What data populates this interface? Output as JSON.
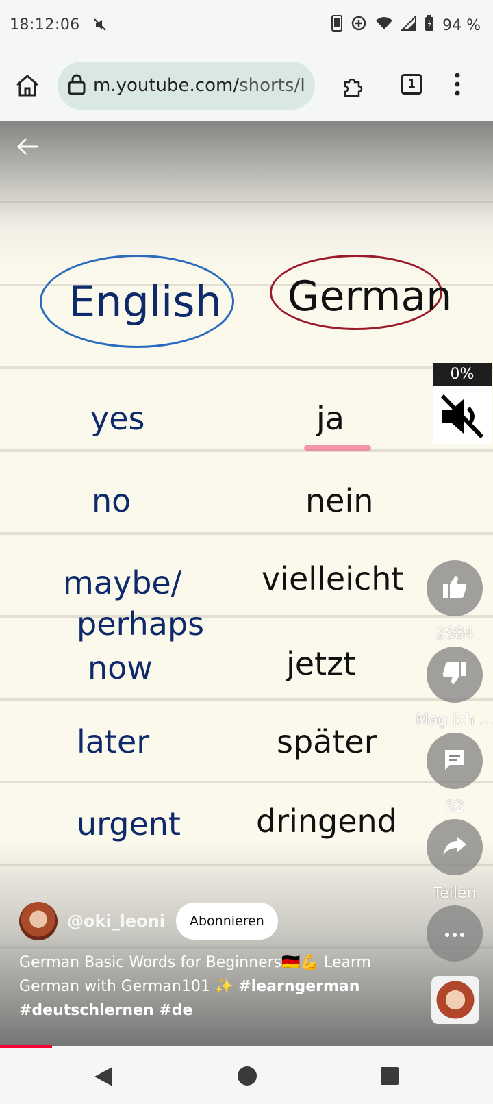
{
  "status": {
    "time": "18:12:06",
    "battery": "94 %"
  },
  "browser": {
    "url_main": "m.youtube.com/",
    "url_path": "shorts/I",
    "tab_count": "1"
  },
  "video": {
    "headers": {
      "left": "English",
      "right": "German"
    },
    "words": [
      {
        "en": "yes",
        "de": "ja"
      },
      {
        "en": "no",
        "de": "nein"
      },
      {
        "en": "maybe/",
        "de": "vielleicht"
      },
      {
        "en": "perhaps",
        "de": ""
      },
      {
        "en": "now",
        "de": "jetzt"
      },
      {
        "en": "later",
        "de": "später"
      },
      {
        "en": "urgent",
        "de": "dringend"
      }
    ],
    "volume_percent": "0%"
  },
  "actions": {
    "likes": "2884",
    "dislike_label": "Mag ich ...",
    "comments": "32",
    "share_label": "Teilen"
  },
  "channel": {
    "handle": "@oki_leoni",
    "subscribe": "Abonnieren"
  },
  "description": {
    "text": "German Basic Words for Beginners🇩🇪💪 Learm German with German101 ✨ ",
    "tags": "#learngerman #deutschlernen #de"
  },
  "colors": {
    "accent": "#ff0033",
    "url_bg": "#d9e8e4",
    "handwriting_blue": "#0e2a6b"
  }
}
